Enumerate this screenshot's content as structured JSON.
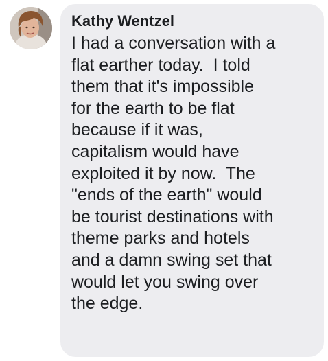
{
  "comment": {
    "author": "Kathy Wentzel",
    "lines": [
      "I had a conversation with a",
      "flat earther today.  I told",
      "them that it's impossible",
      "for the earth to be flat",
      "because if it was,",
      "capitalism would have",
      "exploited it by now.  The",
      "\"ends of the earth\" would",
      "be tourist destinations with",
      "theme parks and hotels",
      "and a damn swing set that",
      "would let you swing over",
      "the edge."
    ]
  },
  "colors": {
    "bubble_background": "#ededf0",
    "text": "#1c1e21"
  },
  "icons": {
    "avatar": "profile-photo"
  }
}
